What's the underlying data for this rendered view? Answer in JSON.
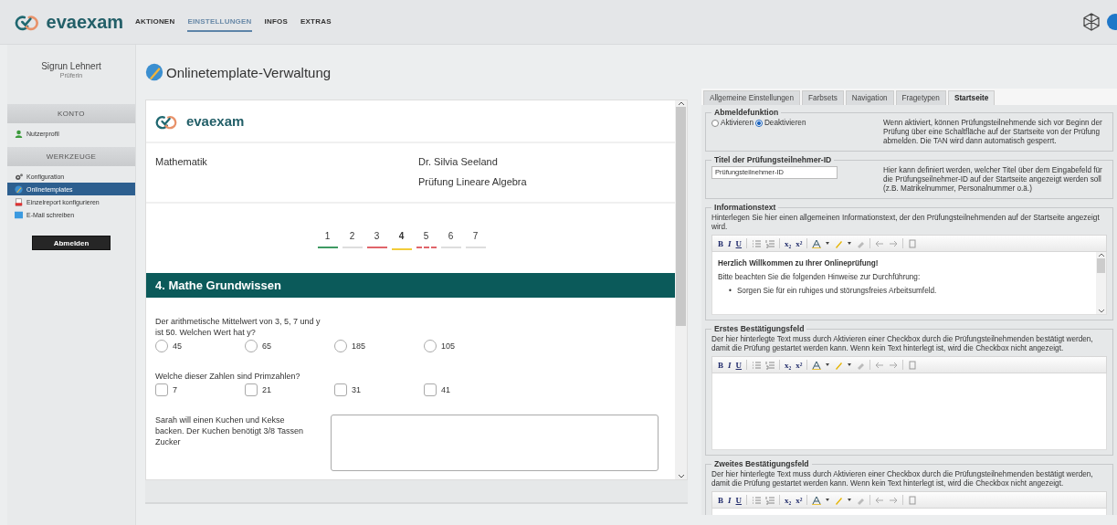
{
  "topbar": {
    "brand": "evaexam",
    "nav": [
      {
        "label": "AKTIONEN",
        "selected": false
      },
      {
        "label": "EINSTELLUNGEN",
        "selected": true
      },
      {
        "label": "INFOS",
        "selected": false
      },
      {
        "label": "EXTRAS",
        "selected": false
      }
    ]
  },
  "sidebar": {
    "user_name": "Sigrun Lehnert",
    "user_role": "Prüferin",
    "sections": [
      {
        "title": "KONTO",
        "items": [
          {
            "label": "Nutzerprofil",
            "selected": false
          }
        ]
      },
      {
        "title": "WERKZEUGE",
        "items": [
          {
            "label": "Konfiguration",
            "selected": false
          },
          {
            "label": "Onlinetemplates",
            "selected": true
          },
          {
            "label": "Einzelreport konfigurieren",
            "selected": false
          },
          {
            "label": "E-Mail schreiben",
            "selected": false
          }
        ]
      }
    ],
    "logout": "Abmelden"
  },
  "page_title": "Onlinetemplate-Verwaltung",
  "preview": {
    "brand": "evaexam",
    "subject": "Mathematik",
    "examiner": "Dr. Silvia Seeland",
    "exam": "Prüfung Lineare Algebra",
    "pages": [
      {
        "label": "1",
        "color": "#3e9a62",
        "kind": "solid",
        "selected": false
      },
      {
        "label": "2",
        "color": "#dddddd",
        "kind": "solid",
        "selected": false
      },
      {
        "label": "3",
        "color": "#e0646a",
        "kind": "solid",
        "selected": false
      },
      {
        "label": "4",
        "color": "#f2cc3a",
        "kind": "solid",
        "selected": true
      },
      {
        "label": "5",
        "color": "#e0646a",
        "kind": "dashed",
        "selected": false
      },
      {
        "label": "6",
        "color": "#dddddd",
        "kind": "solid",
        "selected": false
      },
      {
        "label": "7",
        "color": "#dddddd",
        "kind": "solid",
        "selected": false
      }
    ],
    "section_title": "4. Mathe Grundwissen",
    "questions": [
      {
        "kind": "radio",
        "text": "Der arithmetische Mittelwert von 3, 5, 7 und y ist 50. Welchen Wert hat y?",
        "options": [
          {
            "label": "45",
            "selected": false
          },
          {
            "label": "65",
            "selected": false
          },
          {
            "label": "185",
            "selected": false
          },
          {
            "label": "105",
            "selected": false
          }
        ]
      },
      {
        "kind": "checkbox",
        "text": "Welche dieser Zahlen sind Primzahlen?",
        "options": [
          {
            "label": "7",
            "checked": false
          },
          {
            "label": "21",
            "checked": false
          },
          {
            "label": "31",
            "checked": false
          },
          {
            "label": "41",
            "checked": false
          }
        ]
      },
      {
        "kind": "text",
        "text": "Sarah will einen Kuchen und Kekse backen. Der Kuchen benötigt 3/8 Tassen Zucker"
      }
    ]
  },
  "settings": {
    "tabs": [
      {
        "label": "Allgemeine Einstellungen",
        "selected": false
      },
      {
        "label": "Farbsets",
        "selected": false
      },
      {
        "label": "Navigation",
        "selected": false
      },
      {
        "label": "Fragetypen",
        "selected": false
      },
      {
        "label": "Startseite",
        "selected": true
      }
    ],
    "sections": [
      {
        "kind": "radio",
        "legend": "Abmeldefunktion",
        "options": [
          {
            "label": "Aktivieren",
            "selected": false
          },
          {
            "label": "Deaktivieren",
            "selected": true
          }
        ],
        "help": "Wenn aktiviert, können Prüfungsteilnehmende sich vor Beginn der Prüfung über eine Schaltfläche auf der Startseite von der Prüfung abmelden. Die TAN wird dann automatisch gesperrt."
      },
      {
        "kind": "input",
        "legend": "Titel der Prüfungsteilnehmer-ID",
        "value": "Prüfungsteilnehmer-ID",
        "help": "Hier kann definiert werden, welcher Titel über dem Eingabefeld für die Prüfungseilnehmer-ID auf der Startseite angezeigt werden soll (z.B. Matrikelnummer, Personalnummer o.ä.)"
      },
      {
        "kind": "editor",
        "legend": "Informationstext",
        "description": "Hinterlegen Sie hier einen allgemeinen Informationstext, der den Prüfungsteilnehmenden auf der Startseite angezeigt wird.",
        "toolbar": [
          "B",
          "I",
          "U",
          "x₂",
          "x²"
        ],
        "content": [
          {
            "kind": "heading",
            "text": "Herzlich Willkommen zu Ihrer Onlineprüfung!"
          },
          {
            "kind": "paragraph",
            "text": "Bitte beachten Sie die folgenden Hinweise zur Durchführung:"
          },
          {
            "kind": "bullet",
            "marker": "•",
            "text": "Sorgen Sie für ein ruhiges und störungsfreies Arbeitsumfeld."
          }
        ]
      },
      {
        "kind": "editor",
        "legend": "Erstes Bestätigungsfeld",
        "description": "Der hier hinterlegte Text muss durch Aktivieren einer Checkbox durch die Prüfungsteilnehmenden bestätigt werden, damit die Prüfung gestartet werden kann. Wenn kein Text hinterlegt ist, wird die Checkbox nicht angezeigt.",
        "toolbar": [
          "B",
          "I",
          "U",
          "x₂",
          "x²"
        ]
      },
      {
        "kind": "editor",
        "legend": "Zweites Bestätigungsfeld",
        "description": "Der hier hinterlegte Text muss durch Aktivieren einer Checkbox durch die Prüfungsteilnehmenden bestätigt werden, damit die Prüfung gestartet werden kann. Wenn kein Text hinterlegt ist, wird die Checkbox nicht angezeigt.",
        "toolbar": [
          "B",
          "I",
          "U",
          "x₂",
          "x²"
        ]
      }
    ]
  }
}
